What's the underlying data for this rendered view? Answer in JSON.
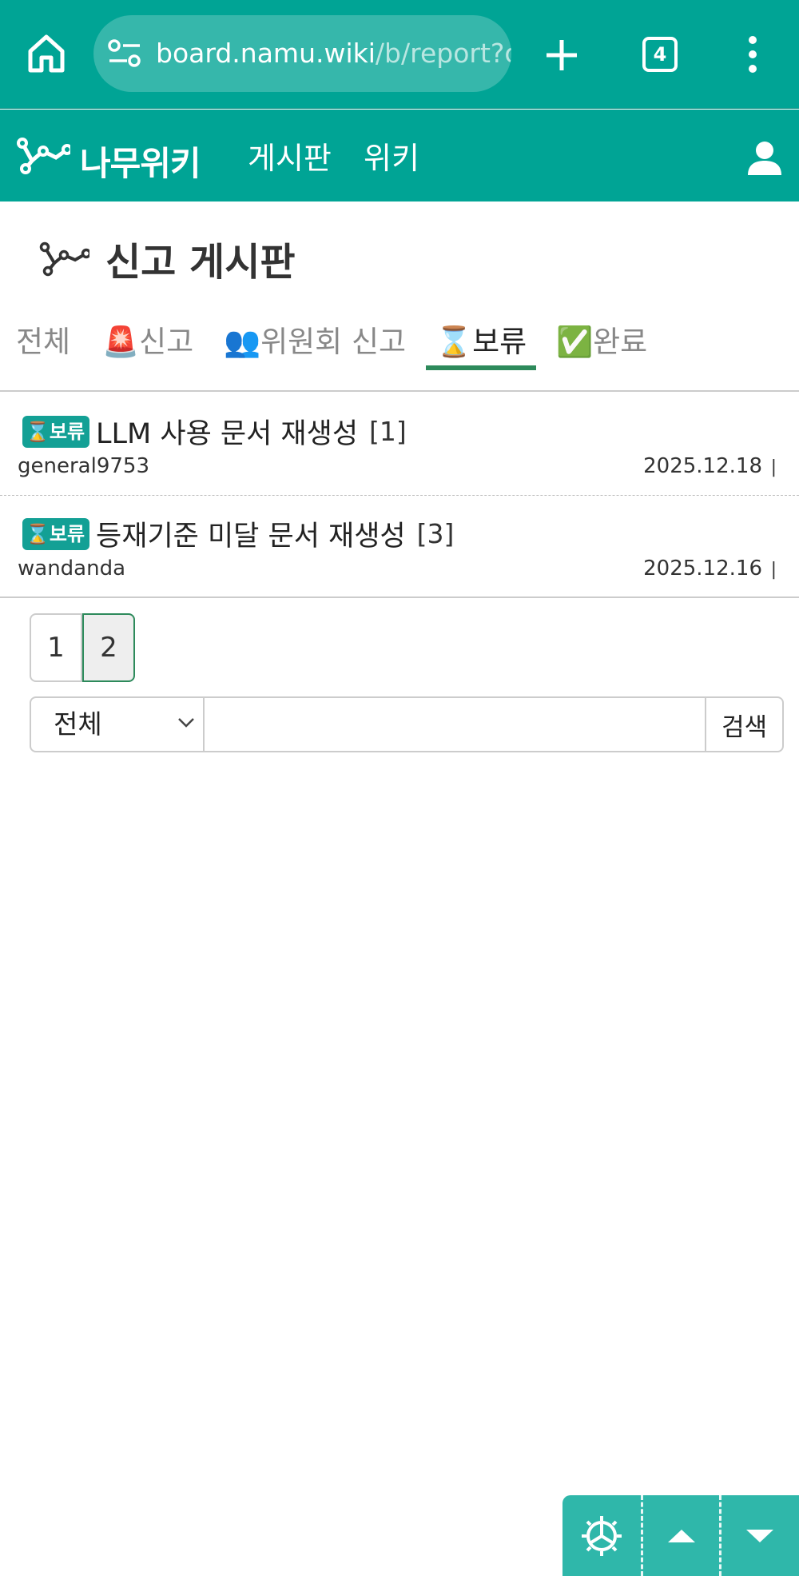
{
  "browser": {
    "url_host": "board.namu.wiki",
    "url_path": "/b/report?c",
    "tab_count": "4"
  },
  "site": {
    "logo_text": "나무위키",
    "nav": [
      "게시판",
      "위키"
    ]
  },
  "board": {
    "title": "신고 게시판"
  },
  "tabs": [
    {
      "label": "전체",
      "active": false
    },
    {
      "label": "🚨신고",
      "active": false
    },
    {
      "label": "👥위원회 신고",
      "active": false
    },
    {
      "label": "⌛보류",
      "active": true
    },
    {
      "label": "✅완료",
      "active": false
    }
  ],
  "posts": [
    {
      "badge": "⌛보류",
      "title": "LLM 사용 문서 재생성",
      "count": "[1]",
      "author": "general9753",
      "date": "2025.12.18",
      "sep": "|"
    },
    {
      "badge": "⌛보류",
      "title": "등재기준 미달 문서 재생성",
      "count": "[3]",
      "author": "wandanda",
      "date": "2025.12.16",
      "sep": "|"
    }
  ],
  "pagination": {
    "pages": [
      "1",
      "2"
    ],
    "current": "2"
  },
  "search": {
    "scope": "전체",
    "input_value": "",
    "button_label": "검색"
  },
  "colors": {
    "brand": "#00a495",
    "active_tab_underline": "#2d8a5b",
    "badge": "#13a095"
  }
}
